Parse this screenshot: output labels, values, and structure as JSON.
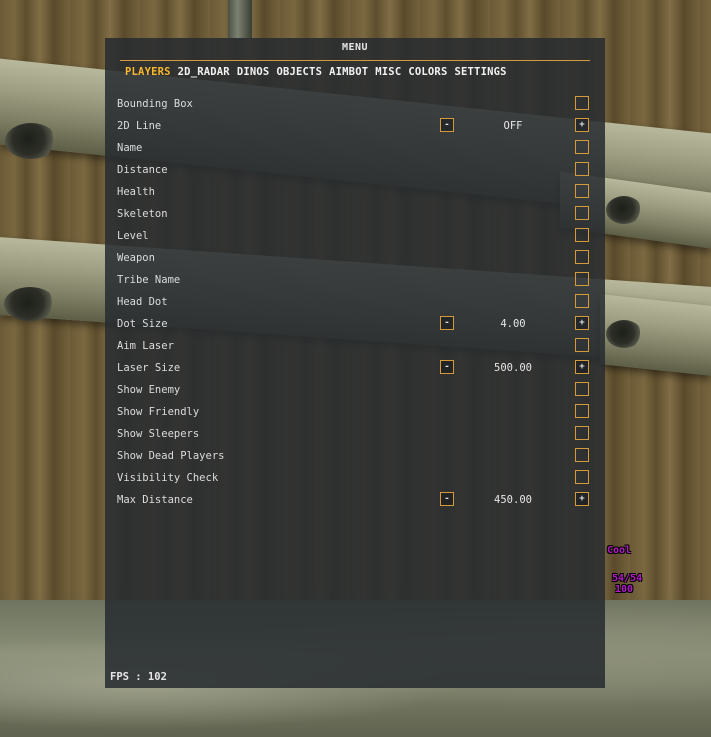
{
  "menu": {
    "title": "MENU",
    "tabs": [
      "PLAYERS",
      "2D_RADAR",
      "DINOS",
      "OBJECTS",
      "AIMBOT",
      "MISC",
      "COLORS",
      "SETTINGS"
    ],
    "active_tab": "PLAYERS",
    "rows": [
      {
        "label": "Bounding Box",
        "type": "checkbox"
      },
      {
        "label": "2D Line",
        "type": "stepper",
        "value": "OFF"
      },
      {
        "label": "Name",
        "type": "checkbox"
      },
      {
        "label": "Distance",
        "type": "checkbox"
      },
      {
        "label": "Health",
        "type": "checkbox"
      },
      {
        "label": "Skeleton",
        "type": "checkbox"
      },
      {
        "label": "Level",
        "type": "checkbox"
      },
      {
        "label": "Weapon",
        "type": "checkbox"
      },
      {
        "label": "Tribe Name",
        "type": "checkbox"
      },
      {
        "label": "Head Dot",
        "type": "checkbox"
      },
      {
        "label": "Dot Size",
        "type": "stepper",
        "value": "4.00"
      },
      {
        "label": "Aim Laser",
        "type": "checkbox"
      },
      {
        "label": "Laser Size",
        "type": "stepper",
        "value": "500.00"
      },
      {
        "label": "Show Enemy",
        "type": "checkbox"
      },
      {
        "label": "Show Friendly",
        "type": "checkbox"
      },
      {
        "label": "Show Sleepers",
        "type": "checkbox"
      },
      {
        "label": "Show Dead Players",
        "type": "checkbox"
      },
      {
        "label": "Visibility Check",
        "type": "checkbox"
      },
      {
        "label": "Max Distance",
        "type": "stepper",
        "value": "450.00"
      }
    ],
    "minus_label": "-",
    "plus_label": "+",
    "fps_label": "FPS : 102"
  },
  "hud": {
    "tag": "Cool",
    "health": "54/54",
    "percent": "100"
  },
  "colors": {
    "accent": "#d59a3a",
    "active_tab": "#f7b82e",
    "hud_text": "#b417c9"
  }
}
